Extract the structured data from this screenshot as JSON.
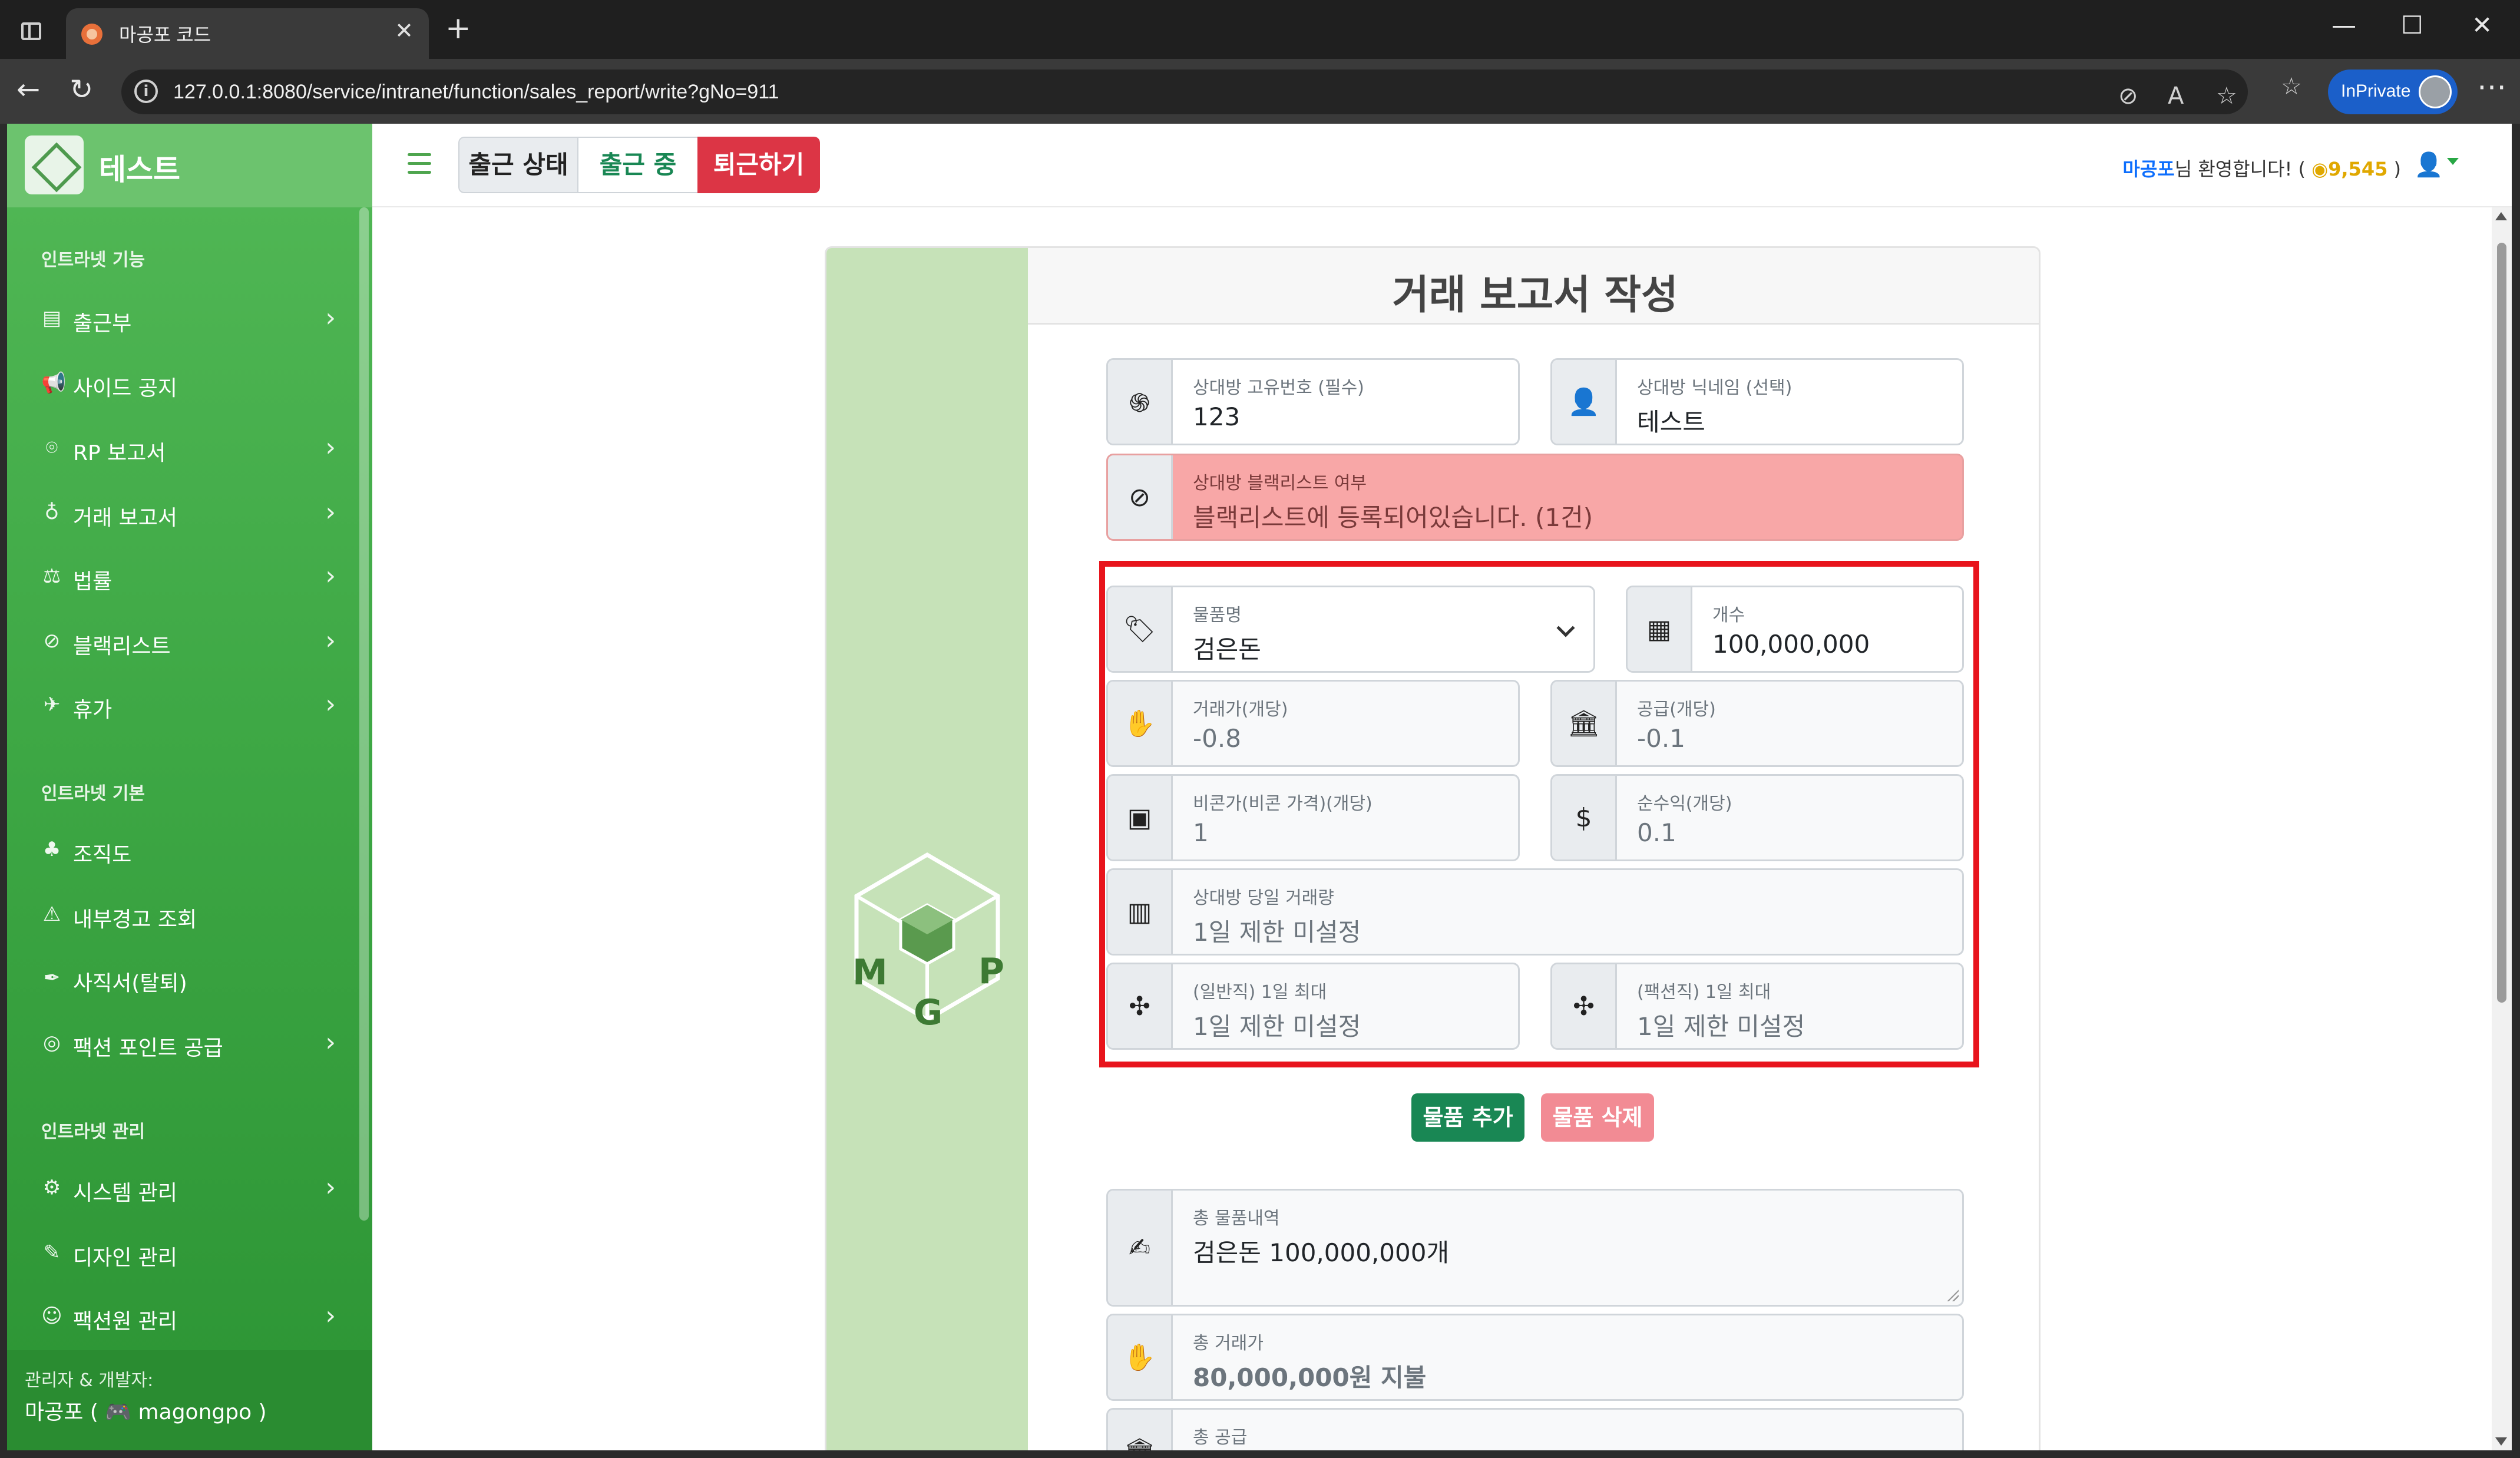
{
  "browser": {
    "tab_title": "마공포 코드",
    "url": "127.0.0.1:8080/service/intranet/function/sales_report/write?gNo=911",
    "inprivate_label": "InPrivate"
  },
  "brand": {
    "name": "테스트"
  },
  "sidebar": {
    "section_function": "인트라넷 기능",
    "section_basic": "인트라넷 기본",
    "section_admin": "인트라넷 관리",
    "items": [
      {
        "label": "출근부",
        "icon": "book-icon",
        "chevron": true
      },
      {
        "label": "사이드 공지",
        "icon": "megaphone-icon",
        "chevron": false
      },
      {
        "label": "RP 보고서",
        "icon": "gamepad-icon",
        "chevron": true
      },
      {
        "label": "거래 보고서",
        "icon": "money-bag-icon",
        "chevron": true
      },
      {
        "label": "법률",
        "icon": "scale-icon",
        "chevron": true
      },
      {
        "label": "블랙리스트",
        "icon": "ban-icon",
        "chevron": true
      },
      {
        "label": "휴가",
        "icon": "plane-icon",
        "chevron": true
      },
      {
        "label": "조직도",
        "icon": "sitemap-icon",
        "chevron": false
      },
      {
        "label": "내부경고 조회",
        "icon": "warning-icon",
        "chevron": false
      },
      {
        "label": "사직서(탈퇴)",
        "icon": "feather-icon",
        "chevron": false
      },
      {
        "label": "팩션 포인트 공급",
        "icon": "coins-icon",
        "chevron": true
      },
      {
        "label": "시스템 관리",
        "icon": "gear-icon",
        "chevron": true
      },
      {
        "label": "디자인 관리",
        "icon": "brush-icon",
        "chevron": false
      },
      {
        "label": "팩션원 관리",
        "icon": "users-gear-icon",
        "chevron": true
      }
    ],
    "footer_line1": "관리자 & 개발자:",
    "footer_line2": "마공포 ( 🎮 magongpo )"
  },
  "topbar": {
    "status_label": "출근 상태",
    "status_value": "출근 중",
    "leave_button": "퇴근하기",
    "welcome_name": "마공포",
    "welcome_text": "님 환영합니다! (",
    "points": "9,545",
    "welcome_close": " )"
  },
  "form": {
    "title": "거래 보고서 작성",
    "partner_id": {
      "label": "상대방 고유번호 (필수)",
      "value": "123"
    },
    "partner_nick": {
      "label": "상대방 닉네임 (선택)",
      "value": "테스트"
    },
    "blacklist": {
      "label": "상대방 블랙리스트 여부",
      "value": "블랙리스트에 등록되어있습니다. (1건)"
    },
    "item_name": {
      "label": "물품명",
      "value": "검은돈"
    },
    "count": {
      "label": "개수",
      "value": "100,000,000"
    },
    "trade_price": {
      "label": "거래가(개당)",
      "value": "-0.8"
    },
    "supply": {
      "label": "공급(개당)",
      "value": "-0.1"
    },
    "beacon_price": {
      "label": "비콘가(비콘 가격)(개당)",
      "value": "1"
    },
    "net_profit": {
      "label": "순수익(개당)",
      "value": "0.1"
    },
    "daily_volume": {
      "label": "상대방 당일 거래량",
      "value": "1일 제한 미설정"
    },
    "general_max": {
      "label": "(일반직) 1일 최대",
      "value": "1일 제한 미설정"
    },
    "faction_max": {
      "label": "(팩션직) 1일 최대",
      "value": "1일 제한 미설정"
    },
    "add_button": "물품 추가",
    "delete_button": "물품 삭제",
    "total_items": {
      "label": "총 물품내역",
      "value": "검은돈 100,000,000개"
    },
    "total_trade": {
      "label": "총 거래가",
      "value": "80,000,000원 지불"
    },
    "total_supply": {
      "label": "총 공급"
    }
  },
  "colors": {
    "sidebar": "#3ea845",
    "brand_bar": "#6cc36e",
    "danger": "#dc3545",
    "success": "#198754",
    "blacklist_bg": "#f8a7a7",
    "highlight": "#e8141c"
  }
}
